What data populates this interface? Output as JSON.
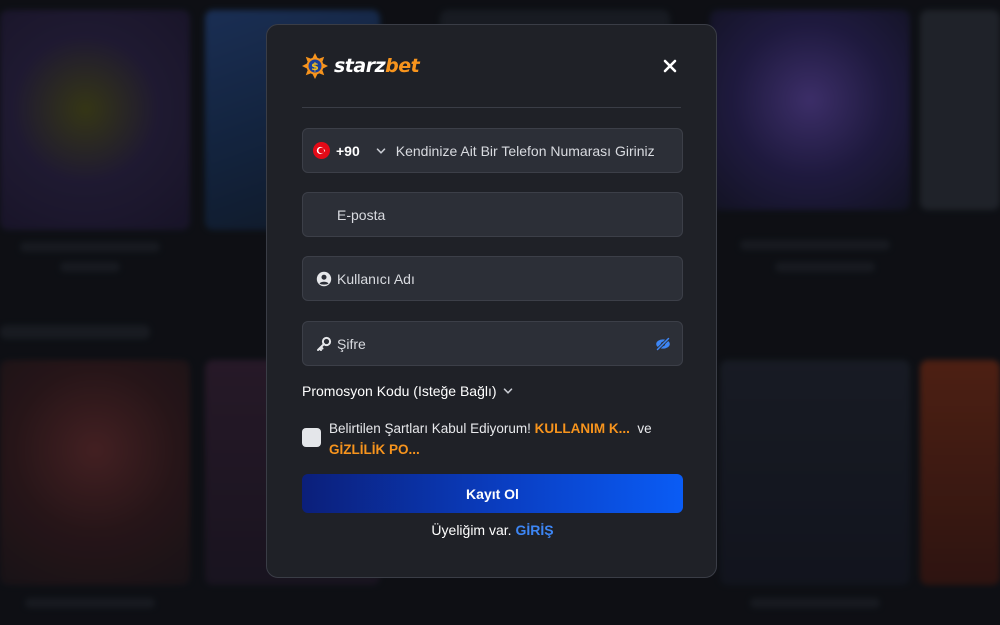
{
  "brand": {
    "name_part1": "starz",
    "name_part2": "bet",
    "colors": {
      "accent": "#f7941d",
      "primary": "#0a5cf5"
    }
  },
  "header": {
    "close_icon": "close-icon"
  },
  "form": {
    "phone": {
      "flag_icon": "turkey-flag-icon",
      "dial_code": "+90",
      "placeholder": "Kendinize Ait Bir Telefon Numarası Giriniz"
    },
    "email": {
      "placeholder": "E-posta"
    },
    "username": {
      "icon": "user-icon",
      "placeholder": "Kullanıcı Adı"
    },
    "password": {
      "icon": "key-icon",
      "placeholder": "Şifre",
      "toggle_icon": "eye-off-icon"
    },
    "promo_label": "Promosyon Kodu (Isteğe Bağlı)",
    "terms": {
      "text": "Belirtilen Şartları Kabul Ediyorum!",
      "link1": "KULLANIM K...",
      "connector": "ve",
      "link2": "GİZLİLİK PO..."
    },
    "submit_label": "Kayıt Ol",
    "login_prompt": "Üyeliğim var.",
    "login_link": "GİRİŞ"
  }
}
